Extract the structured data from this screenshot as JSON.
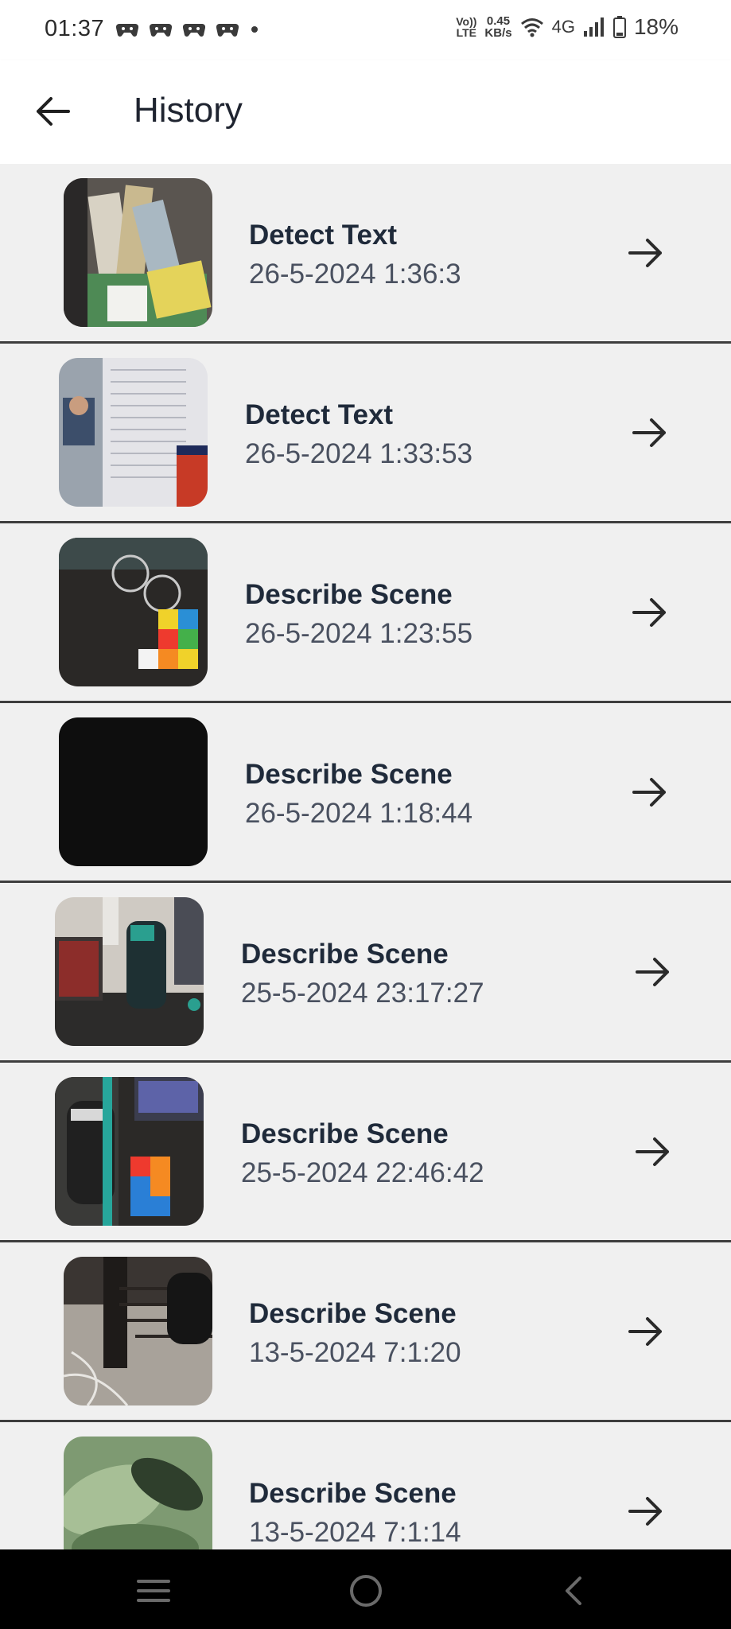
{
  "status_bar": {
    "time": "01:37",
    "volte_line1": "Vo))",
    "volte_line2": "LTE",
    "speed_value": "0.45",
    "speed_unit": "KB/s",
    "network": "4G",
    "battery": "18%"
  },
  "app_bar": {
    "title": "History"
  },
  "history": [
    {
      "title": "Detect Text",
      "date": "26-5-2024 1:36:3",
      "thumb": "papers-books-photo"
    },
    {
      "title": "Detect Text",
      "date": "26-5-2024 1:33:53",
      "thumb": "screen-document-photo"
    },
    {
      "title": "Describe Scene",
      "date": "26-5-2024 1:23:55",
      "thumb": "glasses-cube-photo"
    },
    {
      "title": "Describe Scene",
      "date": "26-5-2024 1:18:44",
      "thumb": "black-photo"
    },
    {
      "title": "Describe Scene",
      "date": "25-5-2024 23:17:27",
      "thumb": "bottle-desk-photo"
    },
    {
      "title": "Describe Scene",
      "date": "25-5-2024 22:46:42",
      "thumb": "bag-cube-photo"
    },
    {
      "title": "Describe Scene",
      "date": "13-5-2024 7:1:20",
      "thumb": "chair-floor-photo"
    },
    {
      "title": "Describe Scene",
      "date": "13-5-2024 7:1:14",
      "thumb": "blurry-green-photo"
    }
  ],
  "colors": {
    "background": "#f0f0f0",
    "title_text": "#1f2a3a",
    "date_text": "#4a5160",
    "divider": "#3e3e3e",
    "nav_bar": "#000000"
  },
  "icons": {
    "back": "arrow-left-icon",
    "row_action": "arrow-right-icon",
    "nav_menu": "menu-icon",
    "nav_home": "home-icon",
    "nav_back": "chevron-left-icon"
  }
}
